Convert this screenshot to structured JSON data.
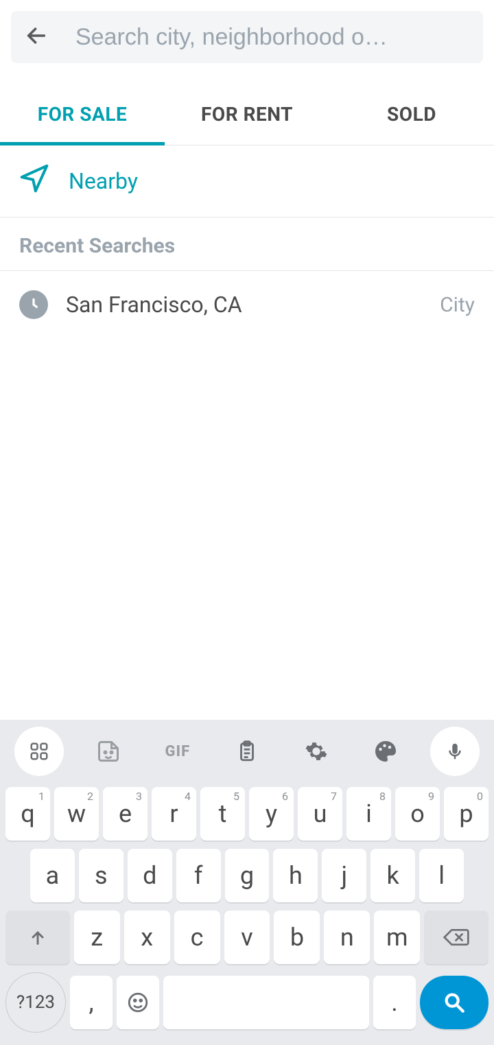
{
  "search": {
    "placeholder": "Search city, neighborhood o…"
  },
  "tabs": {
    "for_sale": "FOR SALE",
    "for_rent": "FOR RENT",
    "sold": "SOLD"
  },
  "nearby": {
    "label": "Nearby"
  },
  "recent": {
    "header": "Recent Searches",
    "items": [
      {
        "name": "San Francisco, CA",
        "type": "City"
      }
    ]
  },
  "keyboard": {
    "toolbar": {
      "gif": "GIF"
    },
    "row1": [
      {
        "k": "q",
        "s": "1"
      },
      {
        "k": "w",
        "s": "2"
      },
      {
        "k": "e",
        "s": "3"
      },
      {
        "k": "r",
        "s": "4"
      },
      {
        "k": "t",
        "s": "5"
      },
      {
        "k": "y",
        "s": "6"
      },
      {
        "k": "u",
        "s": "7"
      },
      {
        "k": "i",
        "s": "8"
      },
      {
        "k": "o",
        "s": "9"
      },
      {
        "k": "p",
        "s": "0"
      }
    ],
    "row2": [
      "a",
      "s",
      "d",
      "f",
      "g",
      "h",
      "j",
      "k",
      "l"
    ],
    "row3": [
      "z",
      "x",
      "c",
      "v",
      "b",
      "n",
      "m"
    ],
    "sym": "?123",
    "comma": ",",
    "period": "."
  }
}
